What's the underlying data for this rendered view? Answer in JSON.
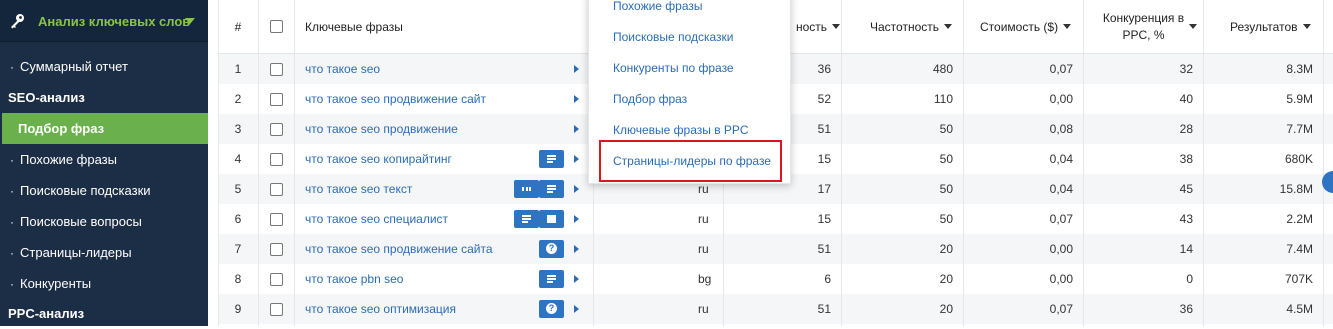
{
  "sidebar": {
    "header_title": "Анализ ключевых слов",
    "items": [
      {
        "label": "Суммарный отчет",
        "bullet": "·",
        "kind": "item"
      },
      {
        "label": "SEO-анализ",
        "kind": "section"
      },
      {
        "label": "Подбор фраз",
        "kind": "active"
      },
      {
        "label": "Похожие фразы",
        "bullet": "·",
        "kind": "item"
      },
      {
        "label": "Поисковые подсказки",
        "bullet": "·",
        "kind": "item"
      },
      {
        "label": "Поисковые вопросы",
        "bullet": "·",
        "kind": "item"
      },
      {
        "label": "Страницы-лидеры",
        "bullet": "·",
        "kind": "item"
      },
      {
        "label": "Конкуренты",
        "bullet": "·",
        "kind": "item"
      },
      {
        "label": "PPC-анализ",
        "kind": "section"
      }
    ]
  },
  "table": {
    "headers": {
      "num": "#",
      "keywords": "Ключевые фразы",
      "difficulty_partial": "ность",
      "frequency": "Частотность",
      "cost": "Стоимость ($)",
      "competition_line1": "Конкуренция в",
      "competition_line2": "PPC, %",
      "results": "Результатов"
    },
    "rows": [
      {
        "n": "1",
        "phrase": "что такое seo",
        "region": "",
        "diff": "36",
        "freq": "480",
        "cost": "0,07",
        "comp": "32",
        "results": "8.3M",
        "buttons": []
      },
      {
        "n": "2",
        "phrase": "что такое seo продвижение сайт",
        "region": "",
        "diff": "52",
        "freq": "110",
        "cost": "0,00",
        "comp": "40",
        "results": "5.9M",
        "buttons": []
      },
      {
        "n": "3",
        "phrase": "что такое seo продвижение",
        "region": "",
        "diff": "51",
        "freq": "50",
        "cost": "0,08",
        "comp": "28",
        "results": "7.7M",
        "buttons": []
      },
      {
        "n": "4",
        "phrase": "что такое seo копирайтинг",
        "region": "",
        "diff": "15",
        "freq": "50",
        "cost": "0,04",
        "comp": "38",
        "results": "680K",
        "buttons": [
          "lines"
        ]
      },
      {
        "n": "5",
        "phrase": "что такое seo текст",
        "region": "ru",
        "diff": "17",
        "freq": "50",
        "cost": "0,04",
        "comp": "45",
        "results": "15.8M",
        "buttons": [
          "bars",
          "lines"
        ]
      },
      {
        "n": "6",
        "phrase": "что такое seo специалист",
        "region": "ru",
        "diff": "15",
        "freq": "50",
        "cost": "0,07",
        "comp": "43",
        "results": "2.2M",
        "buttons": [
          "lines",
          "image"
        ]
      },
      {
        "n": "7",
        "phrase": "что такое seo продвижение сайта",
        "region": "ru",
        "diff": "51",
        "freq": "20",
        "cost": "0,00",
        "comp": "14",
        "results": "7.4M",
        "buttons": [
          "help"
        ]
      },
      {
        "n": "8",
        "phrase": "что такое pbn seo",
        "region": "bg",
        "diff": "6",
        "freq": "20",
        "cost": "0,00",
        "comp": "0",
        "results": "707K",
        "buttons": [
          "lines"
        ]
      },
      {
        "n": "9",
        "phrase": "что такое seo оптимизация",
        "region": "ru",
        "diff": "51",
        "freq": "20",
        "cost": "0,07",
        "comp": "36",
        "results": "4.5M",
        "buttons": [
          "help"
        ]
      }
    ]
  },
  "dropdown": {
    "items": [
      "Похожие фразы",
      "Поисковые подсказки",
      "Конкуренты по фразе",
      "Подбор фраз",
      "Ключевые фразы в PPC",
      "Страницы-лидеры по фразе"
    ],
    "highlighted_index": 5,
    "highlight_color": "#e0141e"
  },
  "colors": {
    "sidebar_bg": "#1b2e45",
    "accent_green": "#6ab04c",
    "link_blue": "#2b6cb3",
    "button_blue": "#2e74c2"
  }
}
